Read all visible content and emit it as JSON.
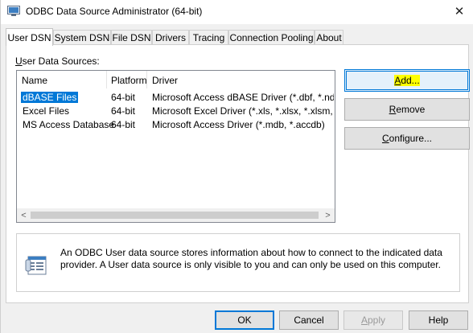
{
  "window": {
    "title": "ODBC Data Source Administrator (64-bit)",
    "close_glyph": "✕"
  },
  "tabs": [
    {
      "label": "User DSN",
      "active": true
    },
    {
      "label": "System DSN"
    },
    {
      "label": "File DSN"
    },
    {
      "label": "Drivers"
    },
    {
      "label": "Tracing"
    },
    {
      "label": "Connection Pooling"
    },
    {
      "label": "About"
    }
  ],
  "panel": {
    "section_label": "User Data Sources:",
    "columns": [
      "Name",
      "Platform",
      "Driver"
    ],
    "rows": [
      {
        "name": "dBASE Files",
        "platform": "64-bit",
        "driver": "Microsoft Access dBASE Driver (*.dbf, *.ndx, *.m",
        "selected": true
      },
      {
        "name": "Excel Files",
        "platform": "64-bit",
        "driver": "Microsoft Excel Driver (*.xls, *.xlsx, *.xlsm, *.xlsb)"
      },
      {
        "name": "MS Access Database",
        "platform": "64-bit",
        "driver": "Microsoft Access Driver (*.mdb, *.accdb)"
      }
    ],
    "scroll_left_glyph": "<",
    "scroll_right_glyph": ">",
    "buttons": {
      "add": "Add...",
      "remove": "Remove",
      "configure": "Configure..."
    },
    "info_text": "An ODBC User data source stores information about how to connect to the indicated data provider.   A User data source is only visible to you and can only be used on this computer."
  },
  "footer": {
    "ok": "OK",
    "cancel": "Cancel",
    "apply": "Apply",
    "help": "Help"
  },
  "colors": {
    "accent": "#0078d7",
    "highlight": "#ffff00"
  }
}
